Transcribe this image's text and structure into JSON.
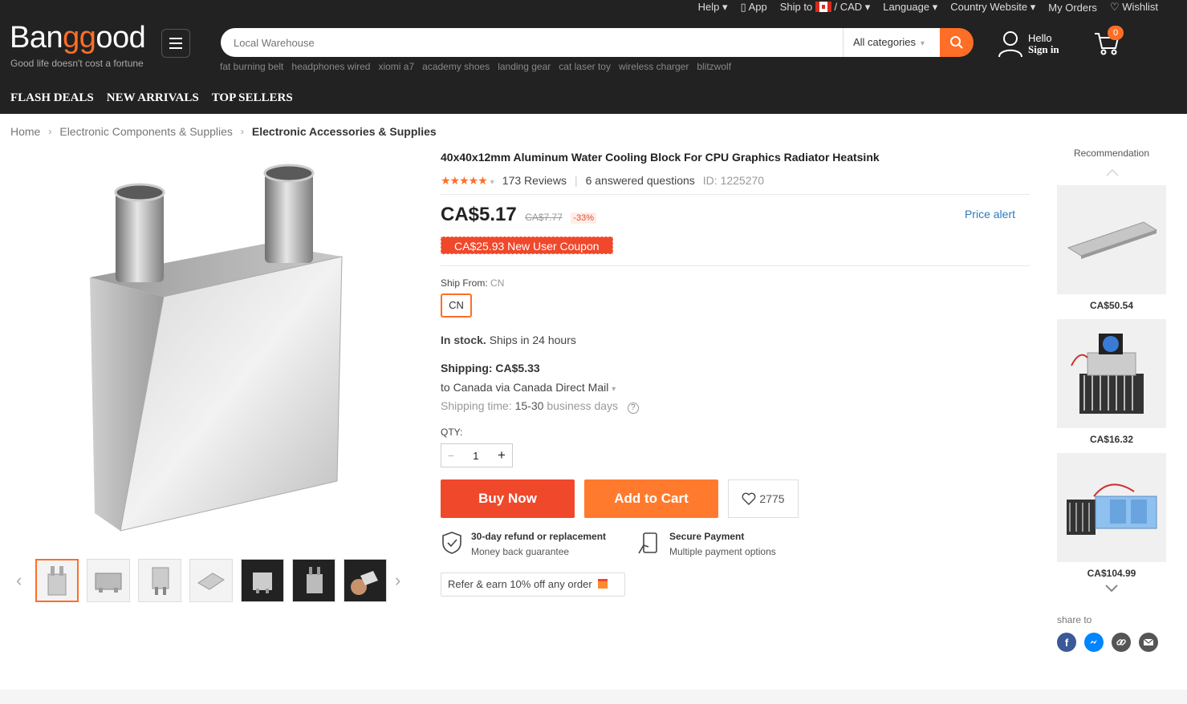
{
  "topbar": {
    "help": "Help ▾",
    "app": "App",
    "ship_to": "Ship to",
    "currency": "/ CAD ▾",
    "language": "Language ▾",
    "country_website": "Country Website ▾",
    "my_orders": "My Orders",
    "wishlist": "Wishlist"
  },
  "brand": {
    "logo_pre": "Ban",
    "logo_mid": "gg",
    "logo_post": "ood",
    "tagline": "Good life doesn't cost a fortune"
  },
  "search": {
    "placeholder": "Local Warehouse",
    "category": "All categories",
    "hot_terms": [
      "fat burning belt",
      "headphones wired",
      "xiomi a7",
      "academy shoes",
      "landing gear",
      "cat laser toy",
      "wireless charger",
      "blitzwolf"
    ]
  },
  "account": {
    "hello": "Hello",
    "sign_in": "Sign in",
    "cart_count": "0"
  },
  "nav": [
    "FLASH DEALS",
    "NEW ARRIVALS",
    "TOP SELLERS"
  ],
  "breadcrumb": [
    "Home",
    "Electronic Components & Supplies",
    "Electronic Accessories & Supplies"
  ],
  "product": {
    "title": "40x40x12mm Aluminum Water Cooling Block For CPU Graphics Radiator Heatsink",
    "stars": "★★★★★",
    "reviews": "173 Reviews",
    "questions": "6 answered questions",
    "id": "ID: 1225270",
    "price": "CA$5.17",
    "old_price": "CA$7.77",
    "discount": "-33%",
    "price_alert": "Price alert",
    "coupon": "CA$25.93 New User Coupon",
    "ship_from_label": "Ship From:",
    "ship_from_value": "CN",
    "ship_option": "CN",
    "stock_bold": "In stock.",
    "stock_text": "Ships in 24 hours",
    "shipping_cost": "Shipping: CA$5.33",
    "shipping_method": "to Canada via Canada Direct Mail",
    "shipping_time_label": "Shipping time:",
    "shipping_time_days": "15-30",
    "shipping_time_unit": "business days",
    "qty_label": "QTY:",
    "qty": "1",
    "buy_now": "Buy Now",
    "add_to_cart": "Add to Cart",
    "wish_count": "2775",
    "refund_title": "30-day refund or replacement",
    "refund_sub": "Money back guarantee",
    "payment_title": "Secure Payment",
    "payment_sub": "Multiple payment options",
    "refer": "Refer & earn 10% off any order"
  },
  "recommendation": {
    "title": "Recommendation",
    "items": [
      {
        "price": "CA$50.54"
      },
      {
        "price": "CA$16.32"
      },
      {
        "price": "CA$104.99"
      }
    ],
    "share_label": "share to"
  },
  "colors": {
    "accent": "#ff6e26",
    "buy": "#f0482b",
    "header": "#222222"
  }
}
